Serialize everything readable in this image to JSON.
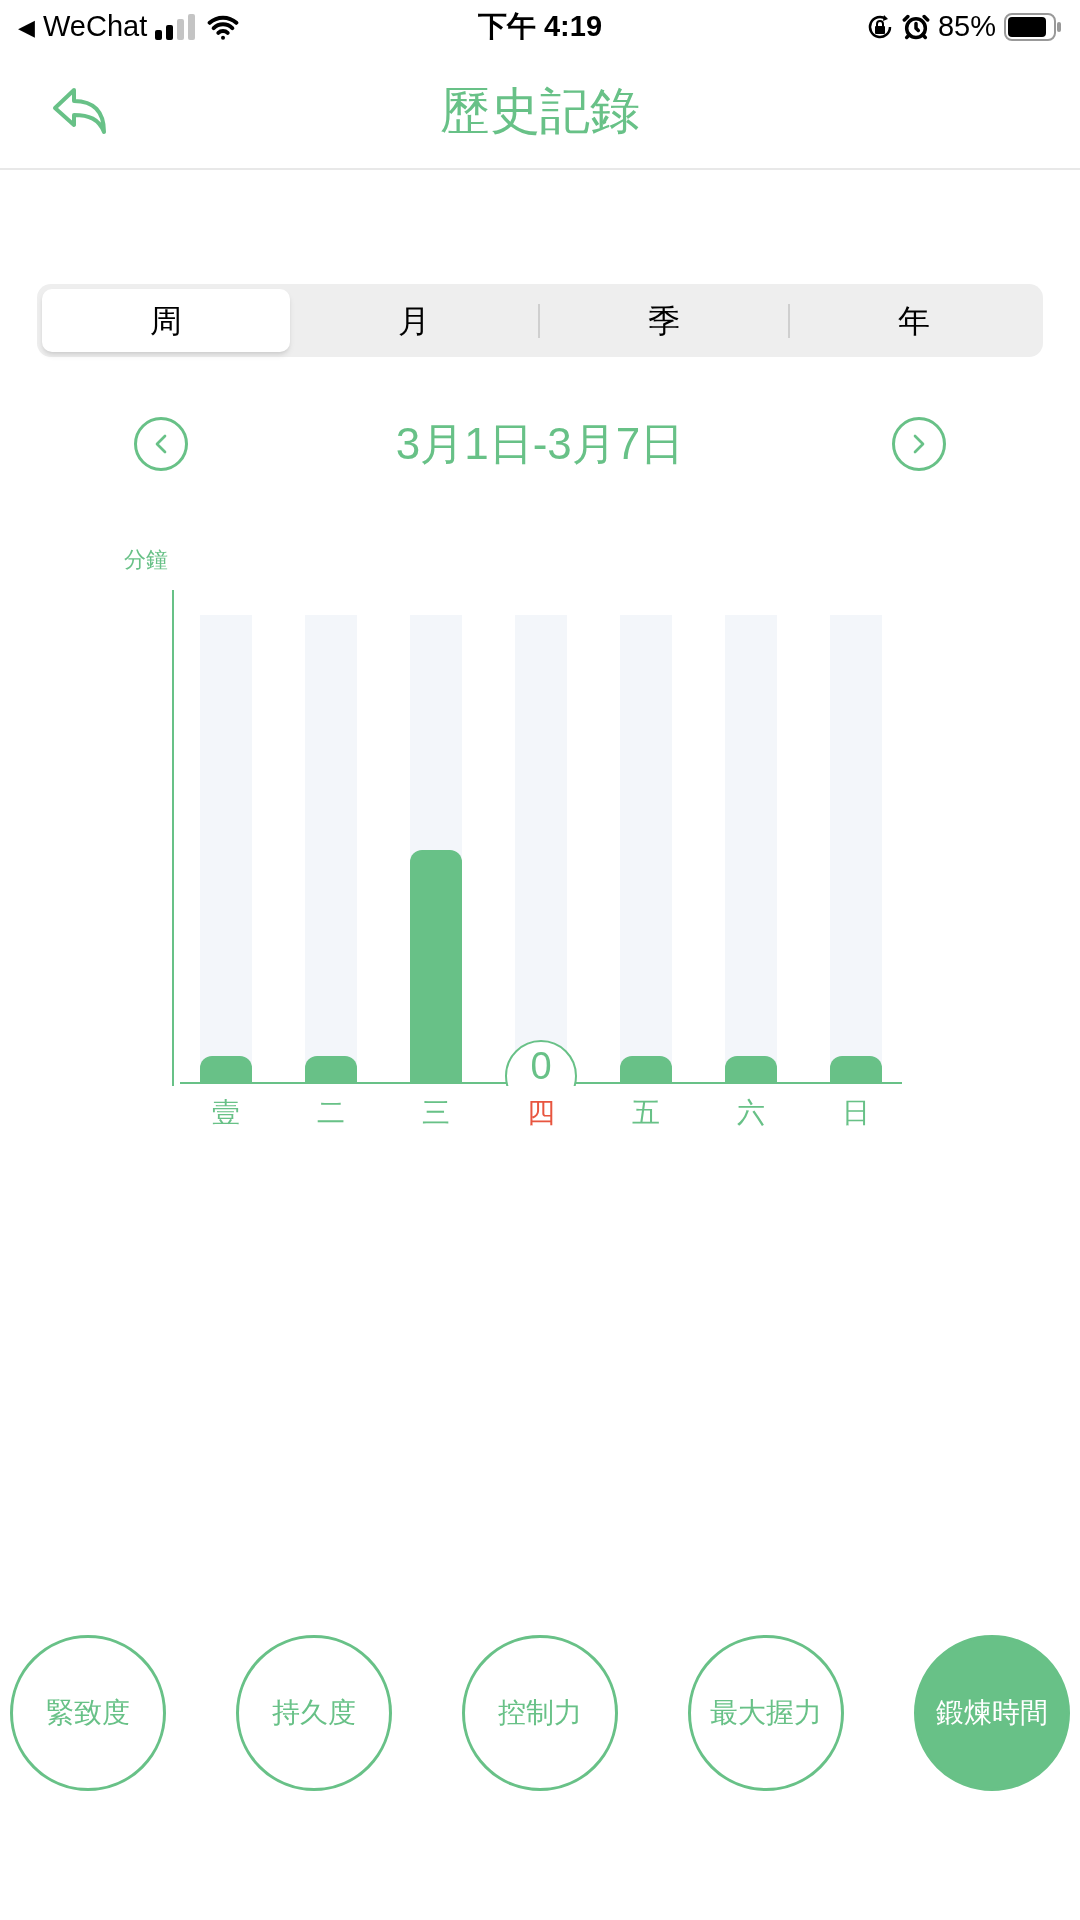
{
  "status_bar": {
    "back_label": "◀",
    "app": "WeChat",
    "time": "下午 4:19",
    "battery": "85%"
  },
  "nav": {
    "title": "歷史記錄"
  },
  "tabs": [
    {
      "label": "周",
      "selected": true
    },
    {
      "label": "月",
      "selected": false
    },
    {
      "label": "季",
      "selected": false
    },
    {
      "label": "年",
      "selected": false
    }
  ],
  "period": {
    "label": "3月1日-3月7日"
  },
  "chart": {
    "unit": "分鐘",
    "days": [
      {
        "label": "壹",
        "level": 0.06,
        "selected": false
      },
      {
        "label": "二",
        "level": 0.06,
        "selected": false
      },
      {
        "label": "三",
        "level": 0.5,
        "selected": false
      },
      {
        "label": "四",
        "selected": true,
        "bubble": "0"
      },
      {
        "label": "五",
        "level": 0.06,
        "selected": false
      },
      {
        "label": "六",
        "level": 0.06,
        "selected": false
      },
      {
        "label": "日",
        "level": 0.06,
        "selected": false
      }
    ]
  },
  "metrics": [
    {
      "label": "緊致度",
      "selected": false
    },
    {
      "label": "持久度",
      "selected": false
    },
    {
      "label": "控制力",
      "selected": false
    },
    {
      "label": "最大握力",
      "selected": false
    },
    {
      "label": "鍛煉時間",
      "selected": true
    }
  ]
}
